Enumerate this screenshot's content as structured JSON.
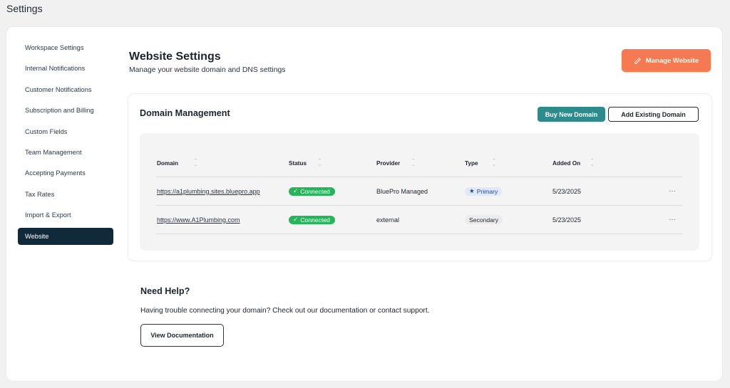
{
  "app": {
    "title": "Settings"
  },
  "sidebar": {
    "items": [
      {
        "label": "Workspace Settings"
      },
      {
        "label": "Internal Notifications"
      },
      {
        "label": "Customer Notifications"
      },
      {
        "label": "Subscription and Billing"
      },
      {
        "label": "Custom Fields"
      },
      {
        "label": "Team Management"
      },
      {
        "label": "Accepting Payments"
      },
      {
        "label": "Tax Rates"
      },
      {
        "label": "Import & Export"
      },
      {
        "label": "Website"
      }
    ],
    "active": "Website"
  },
  "header": {
    "title": "Website Settings",
    "subtitle": "Manage your website domain and DNS settings",
    "manage_button": "Manage Website"
  },
  "domain_management": {
    "title": "Domain Management",
    "buy_button": "Buy New Domain",
    "add_button": "Add Existing Domain",
    "columns": [
      "Domain",
      "Status",
      "Provider",
      "Type",
      "Added On"
    ],
    "rows": [
      {
        "domain": "https://a1plumbing.sites.bluepro.app",
        "status": "Connected",
        "provider": "BluePro Managed",
        "type": "Primary",
        "added_on": "5/23/2025",
        "more": "···"
      },
      {
        "domain": "https://www.A1Plumbing.com",
        "status": "Connected",
        "provider": "external",
        "type": "Secondary",
        "added_on": "5/23/2025",
        "more": "···"
      }
    ]
  },
  "help": {
    "title": "Need Help?",
    "text": "Having trouble connecting your domain? Check out our documentation or contact support.",
    "docs_button": "View Documentation"
  },
  "colors": {
    "accent_orange": "#f57a52",
    "teal": "#2e8b8b",
    "sidebar_active": "#102a3c",
    "connected_green": "#27b55c",
    "primary_badge_bg": "#dfe9fb"
  }
}
